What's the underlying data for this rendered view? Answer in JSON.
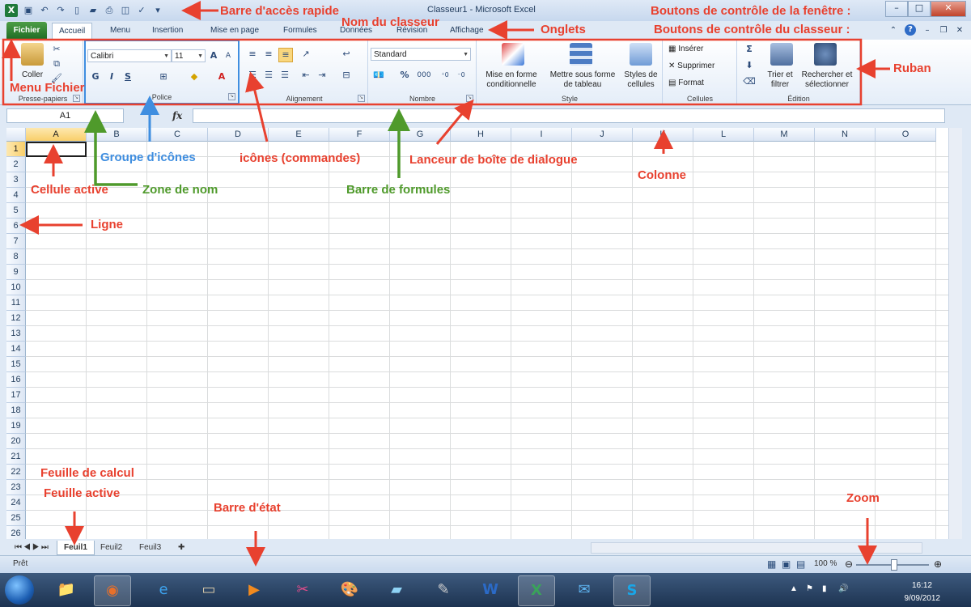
{
  "window": {
    "title": "Classeur1 - Microsoft Excel",
    "controls": [
      "–",
      "□",
      "✕"
    ]
  },
  "tabs": {
    "file": "Fichier",
    "items": [
      "Accueil",
      "Menu",
      "Insertion",
      "Mise en page",
      "Formules",
      "Données",
      "Révision",
      "Affichage"
    ],
    "active": "Accueil"
  },
  "ribbon": {
    "clipboard": {
      "paste": "Coller",
      "label": "Presse-papiers"
    },
    "font": {
      "name": "Calibri",
      "size": "11",
      "bold": "G",
      "italic": "I",
      "underline": "S",
      "label": "Police"
    },
    "alignment": {
      "label": "Alignement"
    },
    "number": {
      "format": "Standard",
      "percent": "%",
      "thousands": "000",
      "label": "Nombre"
    },
    "style": {
      "conditional": "Mise en forme conditionnelle",
      "table": "Mettre sous forme de tableau",
      "cellstyles": "Styles de cellules",
      "label": "Style"
    },
    "cells": {
      "insert": "Insérer",
      "delete": "Supprimer",
      "format": "Format",
      "label": "Cellules"
    },
    "editing": {
      "sum": "Σ",
      "sort": "Trier et filtrer",
      "find": "Rechercher et sélectionner",
      "label": "Édition"
    }
  },
  "formula_bar": {
    "name_box": "A1",
    "fx": "fx",
    "formula": ""
  },
  "grid": {
    "columns": [
      "A",
      "B",
      "C",
      "D",
      "E",
      "F",
      "G",
      "H",
      "I",
      "J",
      "K",
      "L",
      "M",
      "N",
      "O"
    ],
    "rows": [
      "1",
      "2",
      "3",
      "4",
      "5",
      "6",
      "7",
      "8",
      "9",
      "10",
      "11",
      "12",
      "13",
      "14",
      "15",
      "16",
      "17",
      "18",
      "19",
      "20",
      "21",
      "22",
      "23",
      "24",
      "25",
      "26"
    ],
    "active_cell": "A1"
  },
  "sheets": {
    "items": [
      "Feuil1",
      "Feuil2",
      "Feuil3"
    ],
    "active": "Feuil1"
  },
  "status": {
    "text": "Prêt",
    "zoom": "100 %"
  },
  "taskbar": {
    "time": "16:12",
    "date": "9/09/2012"
  },
  "annotations": {
    "qat": "Barre d'accès rapide",
    "workbook_name": "Nom du classeur",
    "window_controls": "Boutons de contrôle de la fenêtre :",
    "tabs": "Onglets",
    "workbook_controls": "Boutons de contrôle du classeur :",
    "ribbon": "Ruban",
    "file_menu": "Menu Fichier",
    "icon_group": "Groupe d'icônes",
    "commands": "icônes (commandes)",
    "dialog_launcher": "Lanceur de boîte de dialogue",
    "active_cell": "Cellule active",
    "name_box": "Zone de nom",
    "formula_bar": "Barre de formules",
    "column": "Colonne",
    "row": "Ligne",
    "worksheet": "Feuille de calcul",
    "active_sheet": "Feuille active",
    "status_bar": "Barre d'état",
    "zoom": "Zoom"
  },
  "colors": {
    "annotation_red": "#e8412f",
    "annotation_green": "#4f9a2b",
    "annotation_blue": "#3f8ee0",
    "excel_green": "#1f7a3a"
  }
}
